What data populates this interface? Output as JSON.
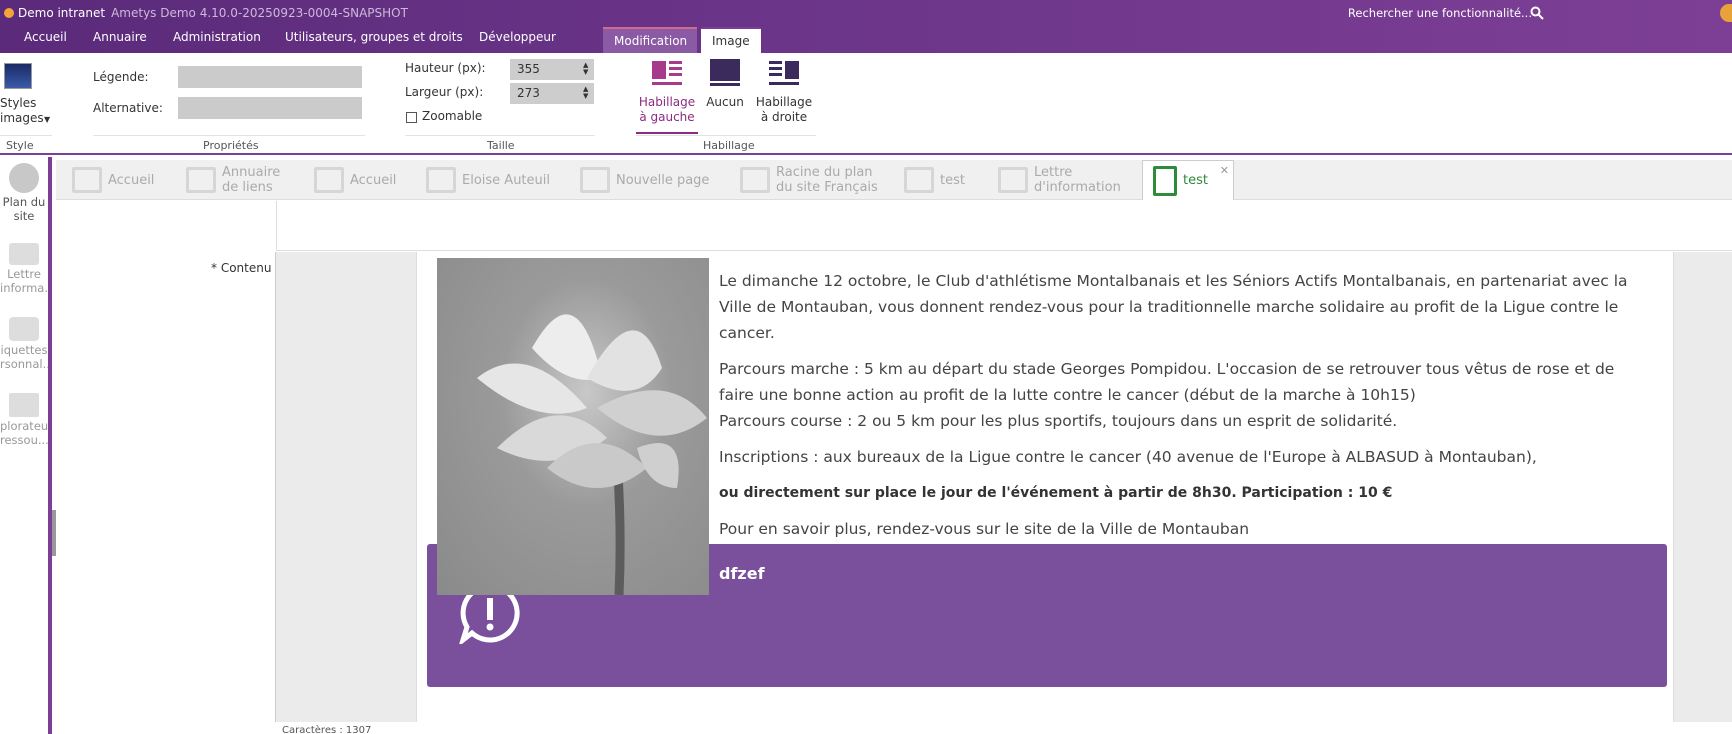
{
  "titlebar": {
    "app_name": "Demo intranet",
    "version": "Ametys Demo 4.10.0-20250923-0004-SNAPSHOT",
    "search_placeholder": "Rechercher une fonctionnalité..."
  },
  "main_tabs": [
    "Accueil",
    "Annuaire",
    "Administration",
    "Utilisateurs, groupes et droits",
    "Développeur"
  ],
  "context_tabs": {
    "modification": "Modification",
    "image": "Image"
  },
  "ribbon": {
    "style_group": {
      "button": "Styles images",
      "label": "Style"
    },
    "properties": {
      "legend_label": "Légende:",
      "alt_label": "Alternative:",
      "group_label": "Propriétés"
    },
    "size": {
      "height_label": "Hauteur (px):",
      "height_value": "355",
      "width_label": "Largeur (px):",
      "width_value": "273",
      "zoom_label": "Zoomable",
      "group_label": "Taille"
    },
    "wrap": {
      "left": "Habillage à gauche",
      "none": "Aucun",
      "right": "Habillage à droite",
      "group_label": "Habillage"
    }
  },
  "sidebar": [
    {
      "label": "Plan du site"
    },
    {
      "label": "Lettre informa..."
    },
    {
      "label": "iquettes rsonnal..."
    },
    {
      "label": "plorateur ressou..."
    }
  ],
  "page_tabs": [
    {
      "label": "Accueil"
    },
    {
      "label": "Annuaire de liens"
    },
    {
      "label": "Accueil"
    },
    {
      "label": "Eloise Auteuil"
    },
    {
      "label": "Nouvelle page"
    },
    {
      "label": "Racine du plan du site Français"
    },
    {
      "label": "test"
    },
    {
      "label": "Lettre d'information"
    },
    {
      "label": "test",
      "active": true
    }
  ],
  "form": {
    "content_label": "* Contenu",
    "paragraphs": [
      "Le dimanche 12 octobre, le Club d'athlétisme Montalbanais et les Séniors Actifs Montalbanais, en partenariat avec la Ville de Montauban, vous donnent rendez-vous pour la traditionnelle marche solidaire au profit de la Ligue contre le cancer.",
      "Parcours marche : 5 km au départ du stade Georges Pompidou. L'occasion de se retrouver tous vêtus de rose et de faire une bonne action au profit de la lutte contre le cancer (début de la marche à 10h15)",
      "Parcours course : 2 ou 5 km pour les plus sportifs, toujours dans un esprit de solidarité.",
      "Inscriptions : aux bureaux de la Ligue contre le cancer (40 avenue de l'Europe à ALBASUD à Montauban),",
      "ou directement sur place le jour de l'événement à partir de 8h30.  Participation : 10 €",
      "Pour en savoir plus, rendez-vous sur le site de la Ville de Montauban"
    ],
    "block_title": "dfzef",
    "status": "Caractères : 1307"
  },
  "colors": {
    "accent": "#7d3f96",
    "block": "#7a4f9c",
    "wrap_active": "#8c2b82"
  }
}
